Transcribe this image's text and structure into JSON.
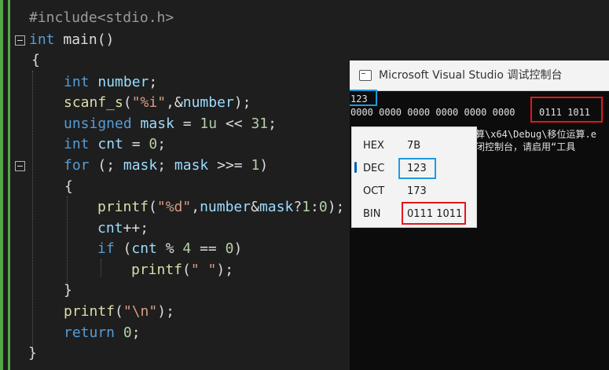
{
  "editor": {
    "lines": [
      [
        [
          "pp",
          "#include<stdio.h>"
        ]
      ],
      [
        [
          "kw",
          "int"
        ],
        [
          "op",
          " main()"
        ]
      ],
      [
        [
          "op",
          "{"
        ]
      ],
      [
        [
          "kw",
          "int"
        ],
        [
          "op",
          " "
        ],
        [
          "var",
          "number"
        ],
        [
          "op",
          ";"
        ]
      ],
      [
        [
          "fn",
          "scanf_s"
        ],
        [
          "op",
          "("
        ],
        [
          "str",
          "\"%i\""
        ],
        [
          "op",
          ",&"
        ],
        [
          "var",
          "number"
        ],
        [
          "op",
          ");"
        ]
      ],
      [
        [
          "kw",
          "unsigned"
        ],
        [
          "op",
          " "
        ],
        [
          "var",
          "mask"
        ],
        [
          "op",
          " = "
        ],
        [
          "num",
          "1u"
        ],
        [
          "op",
          " << "
        ],
        [
          "num",
          "31"
        ],
        [
          "op",
          ";"
        ]
      ],
      [
        [
          "kw",
          "int"
        ],
        [
          "op",
          " "
        ],
        [
          "var",
          "cnt"
        ],
        [
          "op",
          " = "
        ],
        [
          "num",
          "0"
        ],
        [
          "op",
          ";"
        ]
      ],
      [
        [
          "kw",
          "for"
        ],
        [
          "op",
          " (; "
        ],
        [
          "var",
          "mask"
        ],
        [
          "op",
          "; "
        ],
        [
          "var",
          "mask"
        ],
        [
          "op",
          " >>= "
        ],
        [
          "num",
          "1"
        ],
        [
          "op",
          ")"
        ]
      ],
      [
        [
          "op",
          "{"
        ]
      ],
      [
        [
          "fn",
          "printf"
        ],
        [
          "op",
          "("
        ],
        [
          "str",
          "\"%d\""
        ],
        [
          "op",
          ","
        ],
        [
          "var",
          "number"
        ],
        [
          "op",
          "&"
        ],
        [
          "var",
          "mask"
        ],
        [
          "op",
          "?"
        ],
        [
          "num",
          "1"
        ],
        [
          "op",
          ":"
        ],
        [
          "num",
          "0"
        ],
        [
          "op",
          ");"
        ]
      ],
      [
        [
          "var",
          "cnt"
        ],
        [
          "op",
          "++;"
        ]
      ],
      [
        [
          "kw",
          "if"
        ],
        [
          "op",
          " ("
        ],
        [
          "var",
          "cnt"
        ],
        [
          "op",
          " % "
        ],
        [
          "num",
          "4"
        ],
        [
          "op",
          " == "
        ],
        [
          "num",
          "0"
        ],
        [
          "op",
          ")"
        ]
      ],
      [
        [
          "fn",
          "printf"
        ],
        [
          "op",
          "("
        ],
        [
          "str",
          "\" \""
        ],
        [
          "op",
          ");"
        ]
      ],
      [
        [
          "op",
          "}"
        ]
      ],
      [
        [
          "fn",
          "printf"
        ],
        [
          "op",
          "("
        ],
        [
          "str",
          "\"\\n\""
        ],
        [
          "op",
          ");"
        ]
      ],
      [
        [
          "kw",
          "return"
        ],
        [
          "op",
          " "
        ],
        [
          "num",
          "0"
        ],
        [
          "op",
          ";"
        ]
      ],
      [
        [
          "op",
          "}"
        ]
      ]
    ]
  },
  "console": {
    "title": "Microsoft Visual Studio 调试控制台",
    "input_value": "123",
    "output_prefix": "0000 0000 0000 0000 0000 0000",
    "output_highlight": "0111 1011",
    "path_fragment": "算\\x64\\Debug\\移位运算.e",
    "message_fragment": "闭控制台，请启用“工具"
  },
  "calculator": {
    "rows": [
      {
        "label": "HEX",
        "value": "7B"
      },
      {
        "label": "DEC",
        "value": "123"
      },
      {
        "label": "OCT",
        "value": "173"
      },
      {
        "label": "BIN",
        "value": "0111 1011"
      }
    ],
    "selected": "DEC"
  },
  "colors": {
    "highlight_blue": "#1e9ae0",
    "highlight_red": "#e8151b",
    "change_bar_green": "#57a64a"
  }
}
